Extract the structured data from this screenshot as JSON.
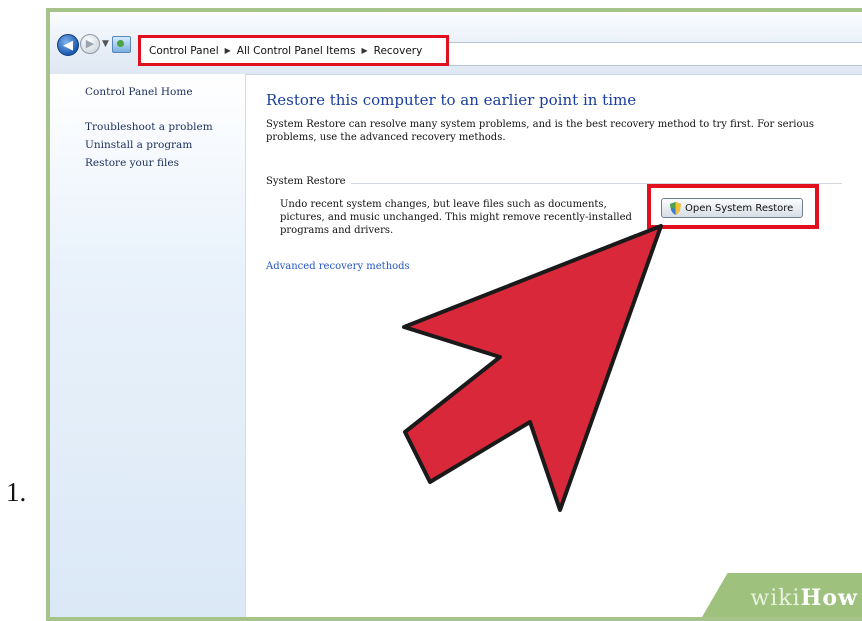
{
  "list_marker": "1.",
  "address_bar": {
    "breadcrumb": [
      "Control Panel",
      "All Control Panel Items",
      "Recovery"
    ]
  },
  "sidebar": {
    "items": [
      {
        "label": "Control Panel Home"
      },
      {
        "label": "Troubleshoot a problem"
      },
      {
        "label": "Uninstall a program"
      },
      {
        "label": "Restore your files"
      }
    ]
  },
  "main": {
    "title": "Restore this computer to an earlier point in time",
    "description": "System Restore can resolve many system problems, and is the best recovery method to try first. For serious problems, use the advanced recovery methods.",
    "system_restore": {
      "group_title": "System Restore",
      "description": "Undo recent system changes, but leave files such as documents, pictures, and music unchanged. This might remove recently-installed programs and drivers.",
      "button_label": "Open System Restore"
    },
    "advanced_link": "Advanced recovery methods"
  },
  "watermark": {
    "part1": "wiki",
    "part2": "How"
  },
  "colors": {
    "highlight": "#e0101e",
    "arrow_fill": "#d9283a",
    "title_blue": "#1a3e9e",
    "link_blue": "#2355c4",
    "frame_green": "#a6c48a"
  },
  "icons": {
    "back": "back-arrow-icon",
    "forward": "forward-arrow-icon",
    "folder": "control-panel-icon",
    "button": "shield-icon",
    "overlay": "pointer-arrow-icon"
  }
}
